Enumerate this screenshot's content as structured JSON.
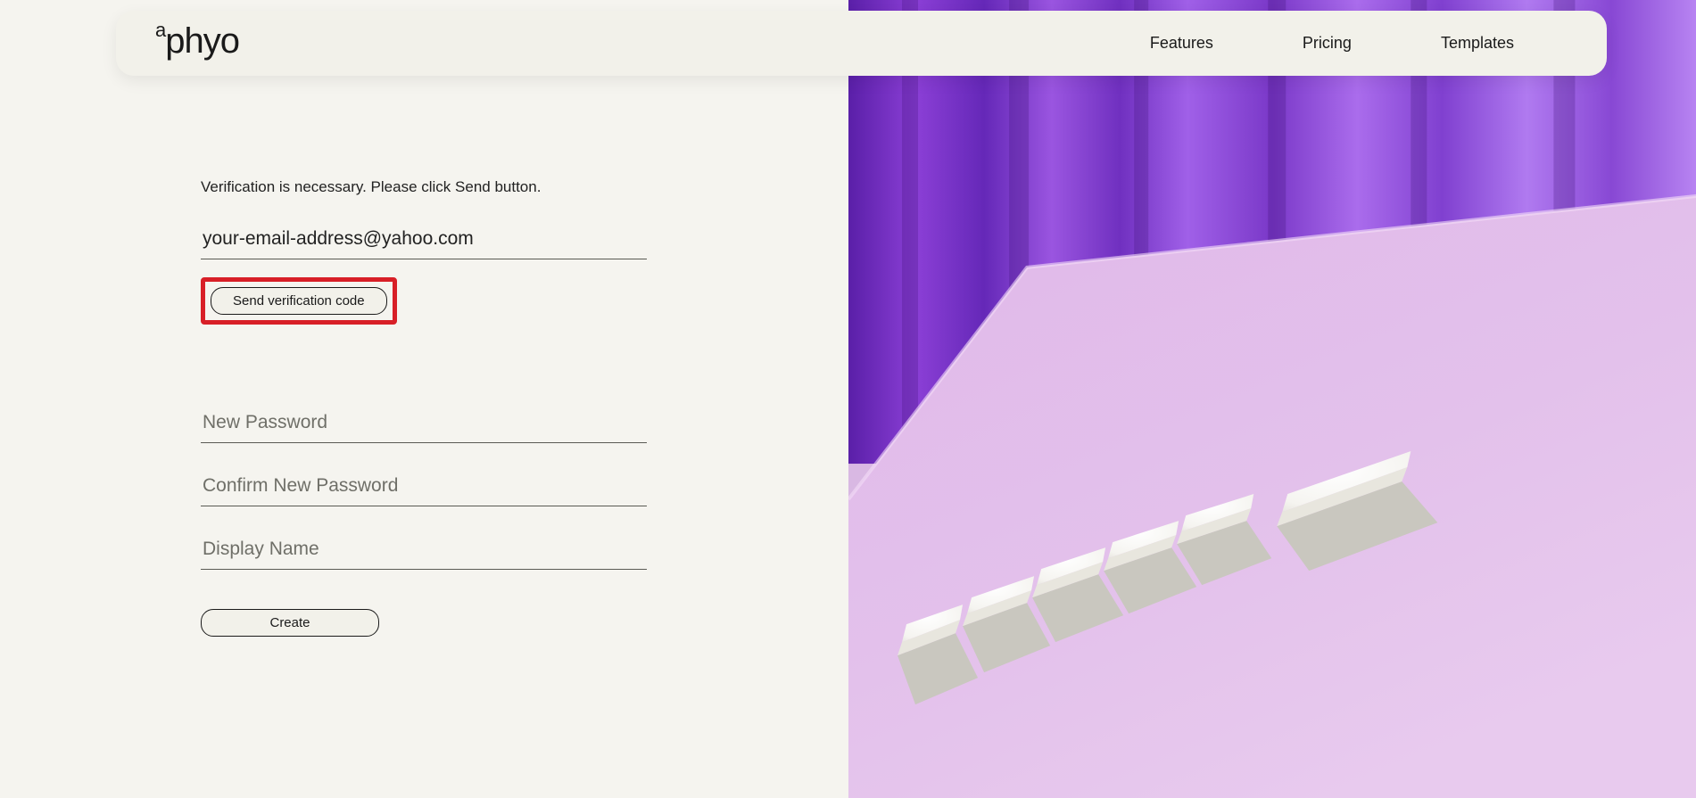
{
  "header": {
    "logo_text": "aphyo",
    "nav": {
      "features": "Features",
      "pricing": "Pricing",
      "templates": "Templates"
    }
  },
  "form": {
    "instruction": "Verification is necessary. Please click Send button.",
    "email_value": "your-email-address@yahoo.com",
    "send_code_label": "Send verification code",
    "new_password_placeholder": "New Password",
    "confirm_password_placeholder": "Confirm New Password",
    "display_name_placeholder": "Display Name",
    "create_label": "Create"
  },
  "colors": {
    "bg": "#f5f4ef",
    "header_bg": "#f2f1ea",
    "highlight": "#d81f27",
    "text": "#1a1a1a"
  },
  "right_image": {
    "description": "Purple curtain background with lilac surface and scattered white keyboard keycaps spelling START plus an Enter key"
  }
}
